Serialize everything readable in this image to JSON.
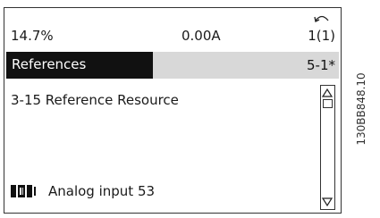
{
  "status": {
    "left": "14.7%",
    "center": "0.00A",
    "right": "1(1)"
  },
  "menu": {
    "label": "References",
    "index": "5-1*"
  },
  "parameter": {
    "title": "3-15 Reference Resource",
    "value": "Analog input 53"
  },
  "icons": {
    "back": "back-arrow-icon",
    "scroll_up": "scroll-up-icon",
    "scroll_down": "scroll-down-icon",
    "value": "terminal-input-icon"
  },
  "document_code": "130BB848.10"
}
